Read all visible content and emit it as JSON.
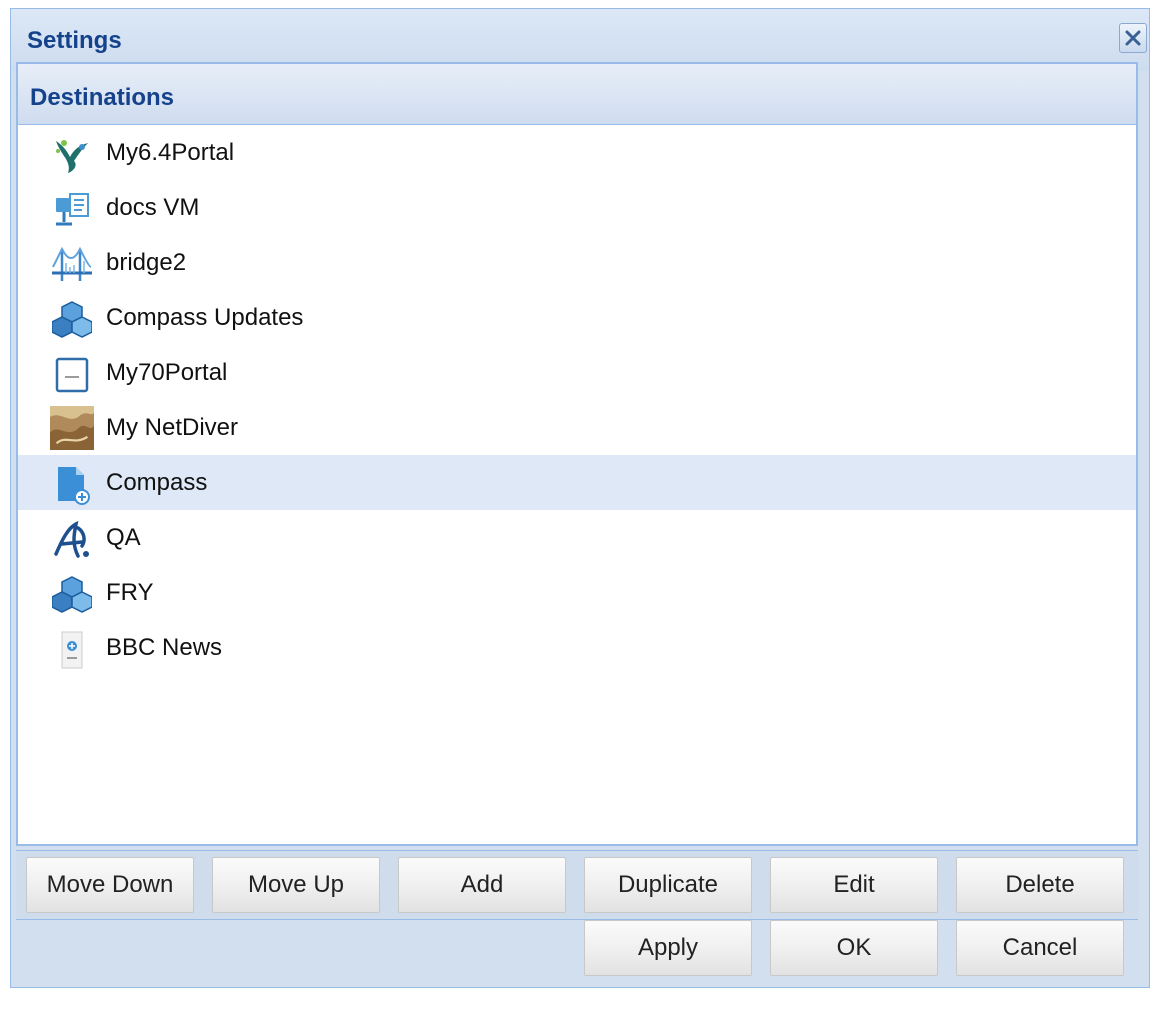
{
  "dialog": {
    "title": "Settings",
    "close_icon": "close-icon"
  },
  "panel": {
    "title": "Destinations"
  },
  "destinations": [
    {
      "label": "My6.4Portal",
      "icon": "bird-logo-icon",
      "selected": false
    },
    {
      "label": "docs VM",
      "icon": "server-document-icon",
      "selected": false
    },
    {
      "label": "bridge2",
      "icon": "bridge-icon",
      "selected": false
    },
    {
      "label": "Compass Updates",
      "icon": "cubes-icon",
      "selected": false
    },
    {
      "label": "My70Portal",
      "icon": "portal-page-icon",
      "selected": false
    },
    {
      "label": "My NetDiver",
      "icon": "netdiver-photo-icon",
      "selected": false
    },
    {
      "label": "Compass",
      "icon": "document-plus-icon",
      "selected": true
    },
    {
      "label": "QA",
      "icon": "qa-logo-icon",
      "selected": false
    },
    {
      "label": "FRY",
      "icon": "cubes-icon",
      "selected": false
    },
    {
      "label": "BBC News",
      "icon": "bbc-news-icon",
      "selected": false
    }
  ],
  "toolbar": {
    "move_down": "Move Down",
    "move_up": "Move Up",
    "add": "Add",
    "duplicate": "Duplicate",
    "edit": "Edit",
    "delete": "Delete"
  },
  "footer": {
    "apply": "Apply",
    "ok": "OK",
    "cancel": "Cancel"
  },
  "colors": {
    "title_text": "#15428b",
    "border": "#99bbe8",
    "selected_row": "#dfe8f6"
  }
}
